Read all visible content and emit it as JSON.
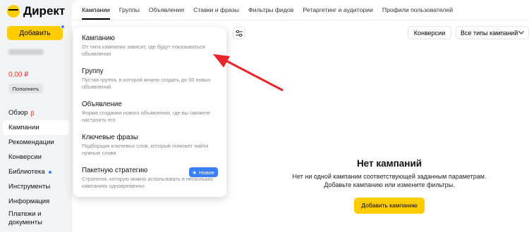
{
  "logo": {
    "text": "Директ"
  },
  "sidebar": {
    "add_label": "Добавить",
    "balance": "0,00 ₽",
    "topup_label": "Пополнить",
    "items": [
      {
        "label": "Обзор",
        "badge": "β"
      },
      {
        "label": "Кампании"
      },
      {
        "label": "Рекомендации"
      },
      {
        "label": "Конверсии"
      },
      {
        "label": "Библиотека"
      },
      {
        "label": "Инструменты"
      },
      {
        "label": "Информация"
      },
      {
        "label": "Платежи и документы"
      }
    ]
  },
  "tabs": [
    "Кампании",
    "Группы",
    "Объявления",
    "Ставки и фразы",
    "Фильтры фидов",
    "Ретаргетинг и аудитории",
    "Профили пользователей"
  ],
  "toolbar": {
    "conversions_label": "Конверсии",
    "type_select_value": "Все типы кампаний"
  },
  "empty_state": {
    "title": "Нет кампаний",
    "line1": "Нет ни одной кампании соответствующей заданным параметрам.",
    "line2": "Добавьте кампанию или измените фильтры.",
    "button_label": "Добавить кампанию"
  },
  "menu": {
    "items": [
      {
        "title": "Кампанию",
        "desc": "От типа кампании зависит, где будут показываться объявления"
      },
      {
        "title": "Группу",
        "desc": "Пустая группа, в которой можно создать до 50 новых объявлений"
      },
      {
        "title": "Объявление",
        "desc": "Форма создания нового объявления, где вы сможете настроить его"
      },
      {
        "title": "Ключевые фразы",
        "desc": "Подборщик ключевых слов, который поможет найти нужные слова"
      },
      {
        "title": "Пакетную стратегию",
        "desc": "Стратегия, которую можно использовать в нескольких кампаниях одновременно",
        "badge": "Новое"
      }
    ]
  },
  "colors": {
    "accent_yellow": "#ffcc00",
    "badge_blue": "#3a7ff6",
    "arrow_red": "#e8232a"
  }
}
